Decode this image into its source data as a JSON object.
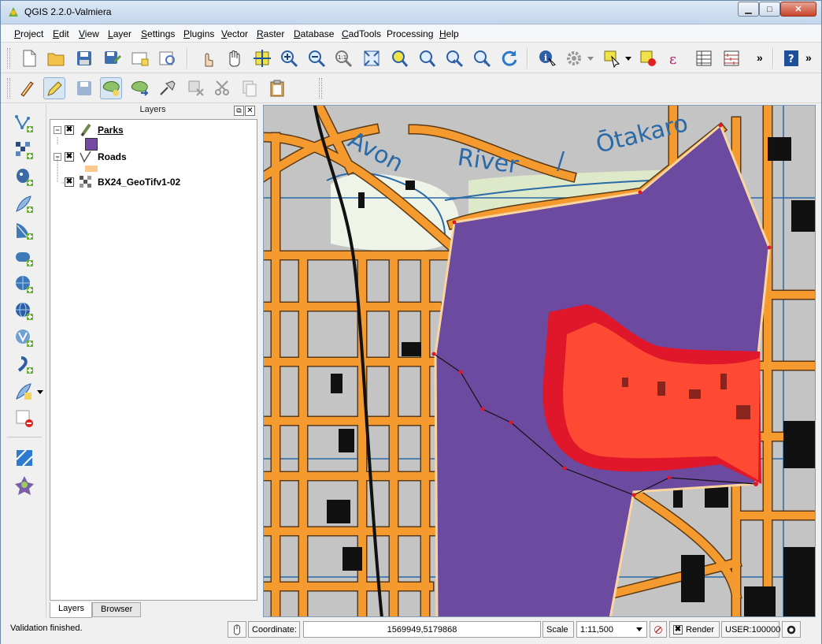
{
  "window": {
    "title": "QGIS 2.2.0-Valmiera",
    "min_glyph": "▁",
    "max_glyph": "□",
    "close_glyph": "✕"
  },
  "menu": [
    "Project",
    "Edit",
    "View",
    "Layer",
    "Settings",
    "Plugins",
    "Vector",
    "Raster",
    "Database",
    "CadTools",
    "Processing",
    "Help"
  ],
  "menu_mnemonics": [
    "P",
    "E",
    "V",
    "L",
    "S",
    "P",
    "V",
    "R",
    "D",
    "C",
    "",
    "H"
  ],
  "toolbar1": {
    "overflow": "»",
    "overflow2": "»"
  },
  "layers_panel": {
    "title": "Layers",
    "float_glyph": "⧉",
    "close_glyph": "✕",
    "items": [
      {
        "name": "Parks",
        "checked": "✖",
        "expander": "−",
        "swatch": "#7349a4"
      },
      {
        "name": "Roads",
        "checked": "✖",
        "expander": "−",
        "swatch": "#f9c98d"
      },
      {
        "name": "BX24_GeoTifv1-02",
        "checked": "✖",
        "expander": ""
      }
    ],
    "tabs": [
      "Layers",
      "Browser"
    ]
  },
  "map": {
    "labels": {
      "avon": "Avon",
      "river": "River",
      "slash": "/",
      "otakaro": "Ōtakaro"
    },
    "colors": {
      "road": "#f59a2f",
      "road_edge": "#5b3a14",
      "park_polygon": "#6b4aa0",
      "buffer_outer": "#e0172a",
      "buffer_inner": "#ff4a33",
      "block": "#c8c8c8",
      "water": "#2a6aa8"
    }
  },
  "statusbar": {
    "message": "Validation finished.",
    "coordinate_label": "Coordinate:",
    "coordinate_value": "1569949,5179868",
    "scale_label": "Scale",
    "scale_value": "1:11,500",
    "render_label": "Render",
    "render_checked": "✖",
    "crs": "USER:100000"
  }
}
